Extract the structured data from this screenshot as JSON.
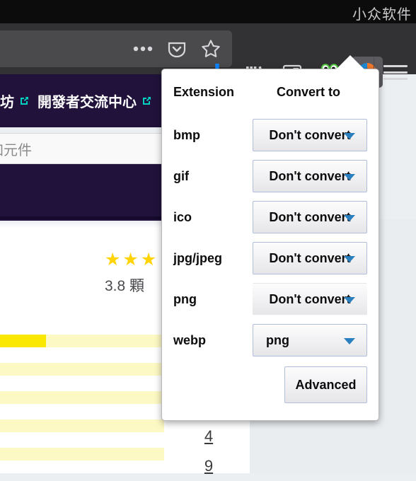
{
  "titlebar": {
    "watermark": "小众软件"
  },
  "toolbar": {
    "overflow_label": "•••",
    "icons": [
      {
        "name": "overflow-menu-icon",
        "label": "•••"
      },
      {
        "name": "pocket-icon",
        "label": "Pocket"
      },
      {
        "name": "bookmark-star-icon",
        "label": "Bookmark"
      },
      {
        "name": "downloads-icon",
        "label": "Downloads"
      },
      {
        "name": "library-icon",
        "label": "Library"
      },
      {
        "name": "sidebar-icon",
        "label": "Sidebars"
      },
      {
        "name": "frog-extension-icon",
        "label": "Extension"
      },
      {
        "name": "image-converter-extension-icon",
        "label": "Image Converter"
      },
      {
        "name": "hamburger-menu-icon",
        "label": "Open menu"
      }
    ]
  },
  "website": {
    "nav_links": [
      {
        "text": "坊",
        "external": true
      },
      {
        "text": "開發者交流中心",
        "external": true
      }
    ],
    "search_placeholder": "找附加元件",
    "rating": {
      "stars_filled": 3,
      "score_text": "3.8 顆",
      "star_glyph": "★"
    },
    "distribution": [
      {
        "fill_percent": 28
      },
      {
        "fill_percent": 0
      },
      {
        "fill_percent": 0
      },
      {
        "fill_percent": 0
      },
      {
        "fill_percent": 0
      }
    ],
    "counts": [
      "4",
      "9"
    ]
  },
  "popup": {
    "columns": {
      "extension": "Extension",
      "convert_to": "Convert to"
    },
    "rows": [
      {
        "extension": "bmp",
        "convert_to": "Don't convert",
        "borderless": false,
        "left_align": false
      },
      {
        "extension": "gif",
        "convert_to": "Don't convert",
        "borderless": false,
        "left_align": false
      },
      {
        "extension": "ico",
        "convert_to": "Don't convert",
        "borderless": false,
        "left_align": false
      },
      {
        "extension": "jpg/jpeg",
        "convert_to": "Don't convert",
        "borderless": false,
        "left_align": false
      },
      {
        "extension": "png",
        "convert_to": "Don't convert",
        "borderless": true,
        "left_align": false
      },
      {
        "extension": "webp",
        "convert_to": "png",
        "borderless": false,
        "left_align": true
      }
    ],
    "advanced_label": "Advanced"
  },
  "colors": {
    "titlebar": "#0c0c0d",
    "navbar": "#323234",
    "site_purple": "#20123a",
    "accent_teal": "#00d1c1",
    "star_yellow": "#ffd402",
    "bar_fill": "#fbe800",
    "bar_track": "#fdf9c4",
    "caret_blue": "#2a7fbe",
    "download_blue": "#0a84ff"
  }
}
